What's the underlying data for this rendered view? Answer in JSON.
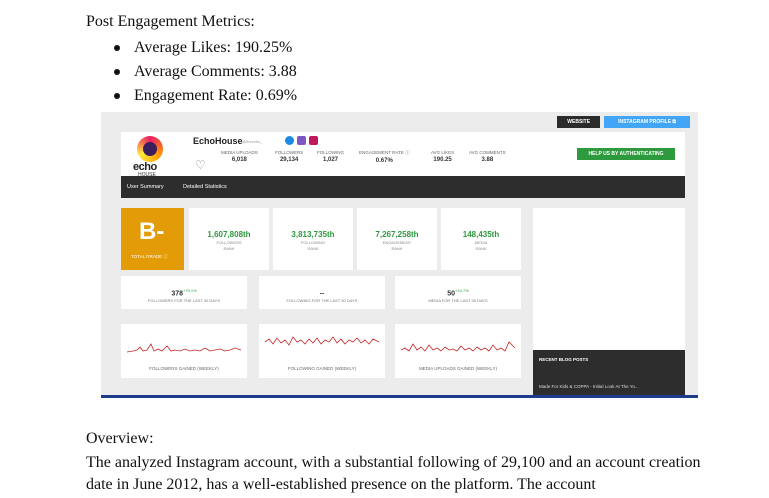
{
  "doc": {
    "title": "Post Engagement Metrics:",
    "bullets": [
      "Average Likes: 190.25%",
      "Average Comments: 3.88",
      "Engagement Rate: 0.69%"
    ],
    "overview_title": "Overview:",
    "overview_text": "The analyzed Instagram account, with a substantial following of 29,100 and an account creation date in June 2012, has a well-established presence on the platform. The account"
  },
  "screenshot": {
    "buttons": {
      "website": "WEBSITE",
      "instagram_profile": "INSTAGRAM PROFILE ⧉",
      "auth": "HELP US BY AUTHENTICATING"
    },
    "profile": {
      "logo_text": "echo",
      "logo_sub": "HOUSE",
      "name": "EchoHouse",
      "handle": "@theecho_",
      "stats": [
        {
          "label": "MEDIA UPLOADS",
          "value": "6,018"
        },
        {
          "label": "FOLLOWERS",
          "value": "29,134"
        },
        {
          "label": "FOLLOWING",
          "value": "1,027"
        },
        {
          "label": "ENGAGEMENT RATE ⓘ",
          "value": "0.67%"
        },
        {
          "label": "AVG LIKES",
          "value": "190.25"
        },
        {
          "label": "AVG COMMENTS",
          "value": "3.88"
        }
      ]
    },
    "tabs": [
      "User Summary",
      "Detailed Statistics"
    ],
    "grade": {
      "value": "B-",
      "label": "TOTAL GRADE ⓘ"
    },
    "ranks": [
      {
        "value": "1,607,808th",
        "label1": "FOLLOWERS",
        "label2": "RANK"
      },
      {
        "value": "3,813,735th",
        "label1": "FOLLOWING",
        "label2": "RANK"
      },
      {
        "value": "7,267,258th",
        "label1": "ENGAGEMENT",
        "label2": "RANK"
      },
      {
        "value": "148,435th",
        "label1": "MEDIA",
        "label2": "RANK"
      }
    ],
    "gains": [
      {
        "value": "378",
        "delta": "+79.1%",
        "label": "FOLLOWERS FOR THE LAST 30 DAYS"
      },
      {
        "value": "--",
        "delta": "",
        "label": "FOLLOWING FOR THE LAST 30 DAYS"
      },
      {
        "value": "50",
        "delta": "+10.7%",
        "label": "MEDIA FOR THE LAST 30 DAYS"
      }
    ],
    "sparks": [
      {
        "label": "FOLLOWERS GAINED (WEEKLY)"
      },
      {
        "label": "FOLLOWING GAINED (WEEKLY)"
      },
      {
        "label": "MEDIA UPLOADS GAINED (WEEKLY)"
      }
    ],
    "blog": {
      "heading": "RECENT BLOG POSTS",
      "post": "Made For Kids & COPPA - Initial Look At The Yo..."
    },
    "colors": {
      "accent_green": "#2e9a3e",
      "grade_orange": "#e39b07",
      "spark_red": "#c62828",
      "ig_blue": "#42a5f5"
    }
  }
}
